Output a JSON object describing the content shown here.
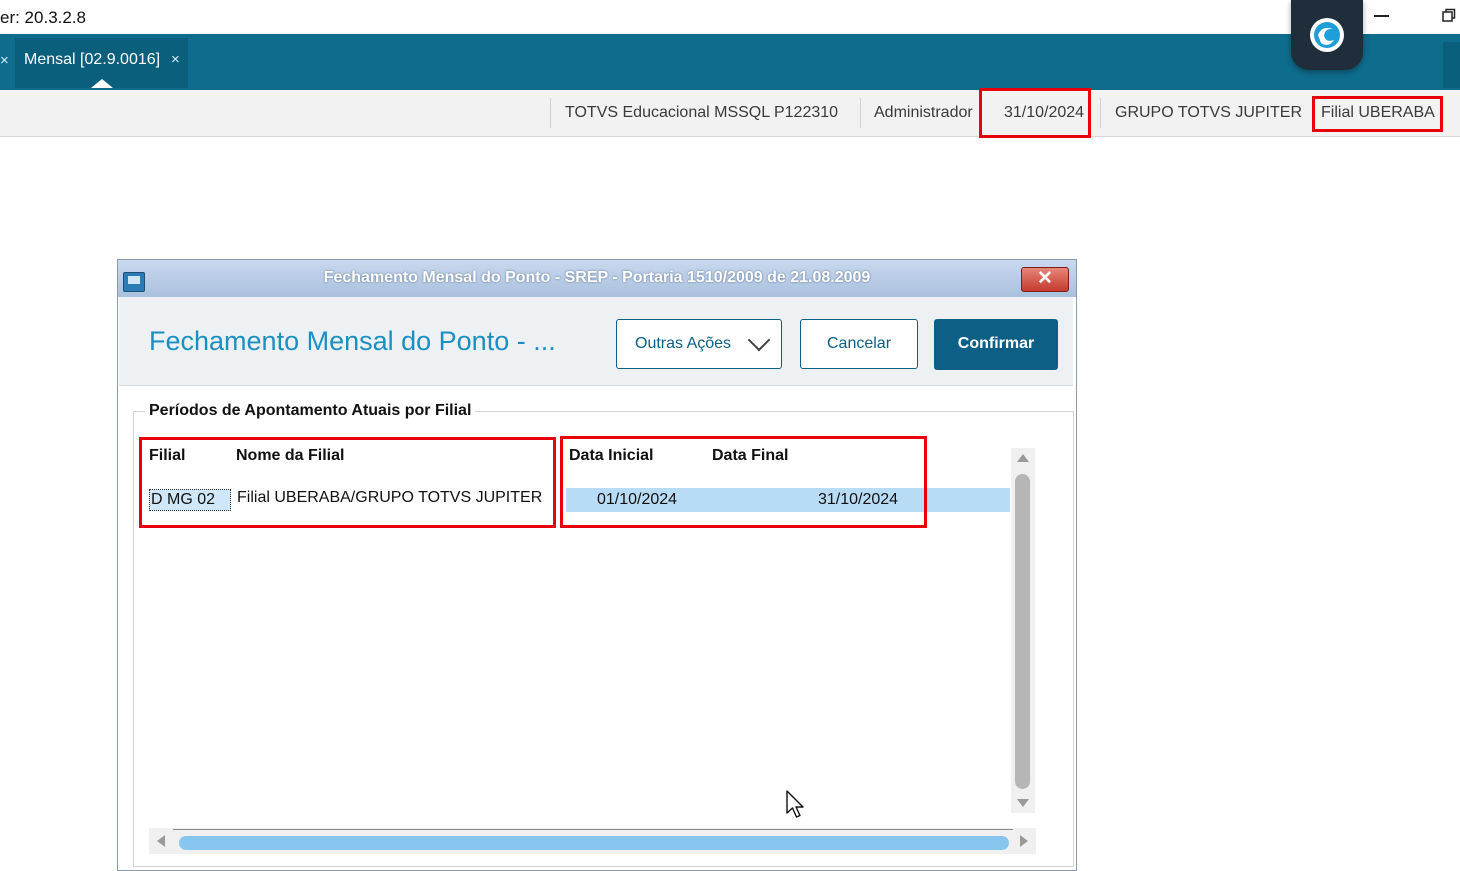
{
  "os_window": {
    "title": "er: 20.3.2.8"
  },
  "tabs": [
    {
      "label": "Mensal [02.9.0016]",
      "close_glyph": "×"
    }
  ],
  "tab_prev_close_glyph": "×",
  "status_bar": {
    "environment": "TOTVS Educacional MSSQL P122310",
    "user": "Administrador",
    "date": "31/10/2024",
    "group": "GRUPO TOTVS JUPITER",
    "branch": "Filial UBERABA"
  },
  "dialog": {
    "title": "Fechamento Mensal do Ponto - SREP - Portaria 1510/2009 de 21.08.2009",
    "close_glyph": "✕",
    "heading": "Fechamento Mensal do Ponto - ...",
    "buttons": {
      "other_actions": "Outras Ações",
      "cancel": "Cancelar",
      "confirm": "Confirmar"
    },
    "group_title": "Períodos de Apontamento Atuais por Filial",
    "table": {
      "columns": [
        "Filial",
        "Nome da Filial",
        "Data Inicial",
        "Data Final"
      ],
      "rows": [
        {
          "filial": "D MG 02",
          "nome": "Filial UBERABA/GRUPO TOTVS JUPITER",
          "data_inicial": "01/10/2024",
          "data_final": "31/10/2024"
        }
      ]
    }
  },
  "colors": {
    "tabbar": "#0e6c8c",
    "accent": "#1a8fc1",
    "confirm_button": "#0d5f86",
    "highlight": "#e8000b",
    "row_selection": "#b9dcf6"
  },
  "icons": [
    "app-logo-icon",
    "minimize-icon",
    "restore-icon",
    "dialog-app-icon",
    "dialog-close-icon",
    "chevron-down-icon",
    "scroll-up-icon",
    "scroll-down-icon",
    "scroll-left-icon",
    "scroll-right-icon",
    "mouse-cursor-icon"
  ]
}
